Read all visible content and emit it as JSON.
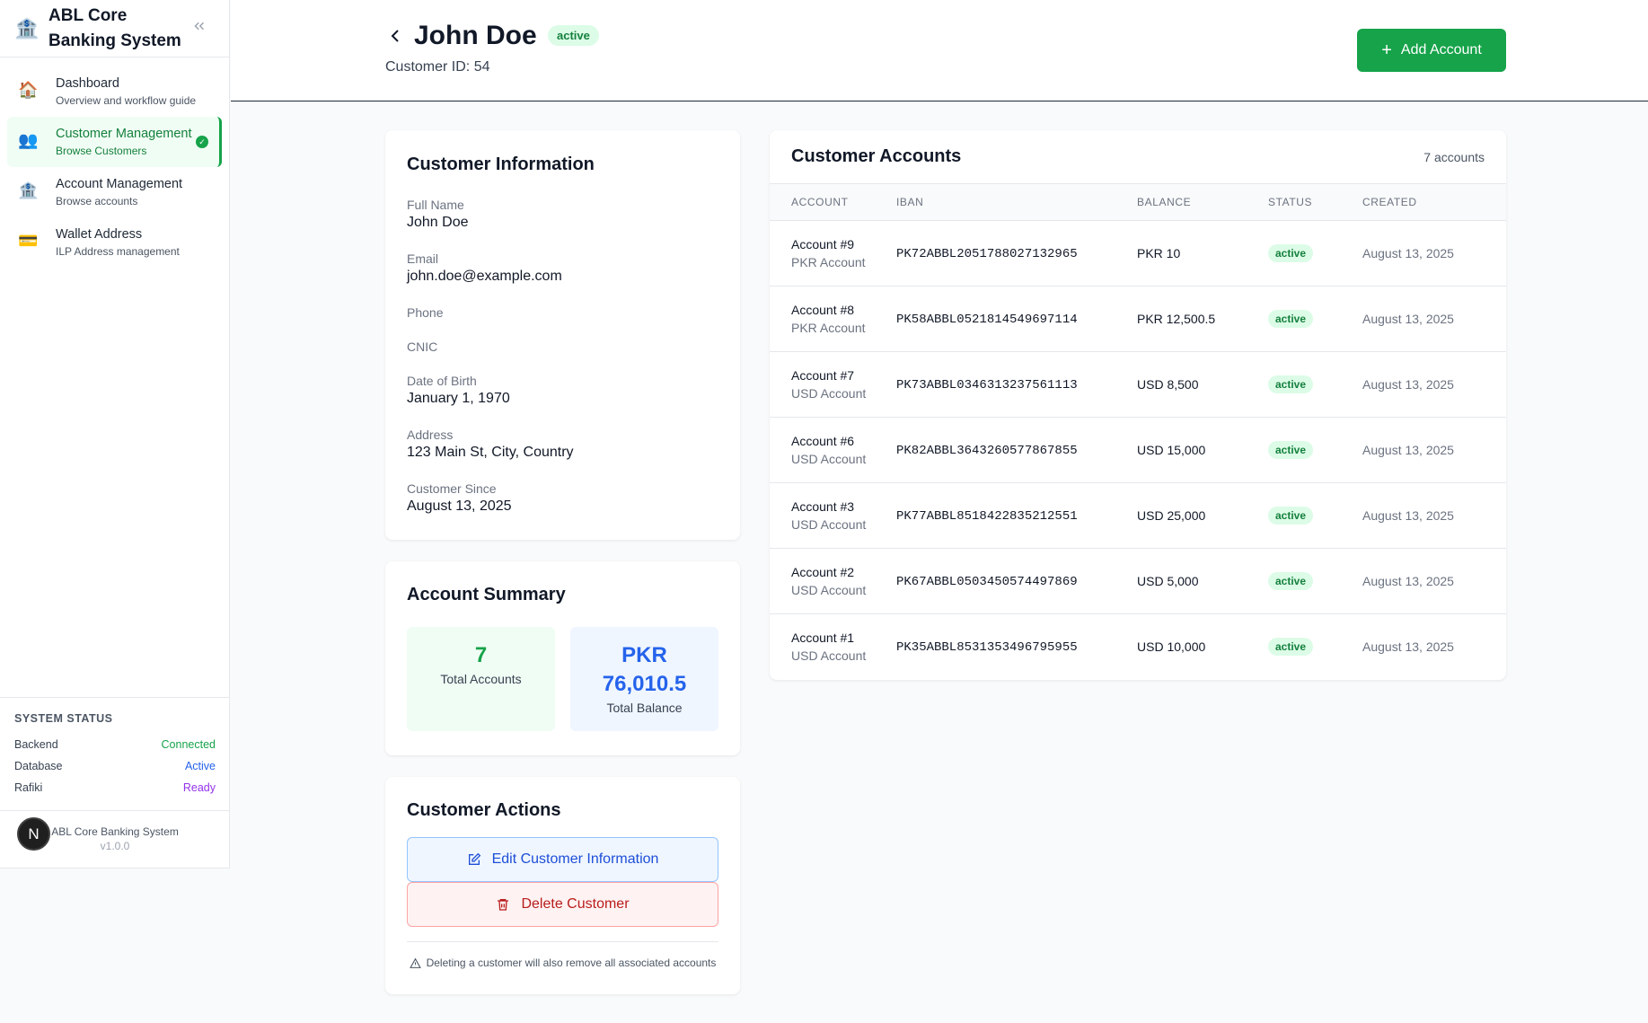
{
  "sidebar": {
    "brand": "ABL Core Banking System",
    "items": [
      {
        "label": "Dashboard",
        "sub": "Overview and workflow guide",
        "icon": "home-icon"
      },
      {
        "label": "Customer Management",
        "sub": "Browse Customers",
        "icon": "users-icon"
      },
      {
        "label": "Account Management",
        "sub": "Browse accounts",
        "icon": "bank-icon"
      },
      {
        "label": "Wallet Address",
        "sub": "ILP Address management",
        "icon": "card-icon"
      }
    ],
    "status": {
      "title": "SYSTEM STATUS",
      "rows": [
        {
          "name": "Backend",
          "value": "Connected",
          "color": "#16a34a"
        },
        {
          "name": "Database",
          "value": "Active",
          "color": "#2563eb"
        },
        {
          "name": "Rafiki",
          "value": "Ready",
          "color": "#9333ea"
        }
      ]
    },
    "footer": {
      "name": "ABL Core Banking System",
      "version": "v1.0.0",
      "avatar": "N"
    }
  },
  "header": {
    "name": "John Doe",
    "status": "active",
    "customer_id": "Customer ID: 54",
    "add_button": "Add Account"
  },
  "info": {
    "title": "Customer Information",
    "fields": [
      {
        "label": "Full Name",
        "value": "John Doe"
      },
      {
        "label": "Email",
        "value": "john.doe@example.com"
      },
      {
        "label": "Phone",
        "value": ""
      },
      {
        "label": "CNIC",
        "value": ""
      },
      {
        "label": "Date of Birth",
        "value": "January 1, 1970"
      },
      {
        "label": "Address",
        "value": "123 Main St, City, Country"
      },
      {
        "label": "Customer Since",
        "value": "August 13, 2025"
      }
    ]
  },
  "summary": {
    "title": "Account Summary",
    "total_accounts": "7",
    "total_accounts_label": "Total Accounts",
    "total_balance_currency": "PKR",
    "total_balance": "76,010.5",
    "total_balance_label": "Total Balance"
  },
  "actions": {
    "title": "Customer Actions",
    "edit": "Edit Customer Information",
    "delete": "Delete Customer",
    "warning": "Deleting a customer will also remove all associated accounts"
  },
  "accounts": {
    "title": "Customer Accounts",
    "count": "7 accounts",
    "columns": [
      "Account",
      "IBAN",
      "Balance",
      "Status",
      "Created"
    ],
    "rows": [
      {
        "account": "Account #9",
        "type": "PKR Account",
        "iban": "PK72ABBL2051788027132965",
        "balance": "PKR 10",
        "status": "active",
        "created": "August 13, 2025"
      },
      {
        "account": "Account #8",
        "type": "PKR Account",
        "iban": "PK58ABBL0521814549697114",
        "balance": "PKR 12,500.5",
        "status": "active",
        "created": "August 13, 2025"
      },
      {
        "account": "Account #7",
        "type": "USD Account",
        "iban": "PK73ABBL0346313237561113",
        "balance": "USD 8,500",
        "status": "active",
        "created": "August 13, 2025"
      },
      {
        "account": "Account #6",
        "type": "USD Account",
        "iban": "PK82ABBL3643260577867855",
        "balance": "USD 15,000",
        "status": "active",
        "created": "August 13, 2025"
      },
      {
        "account": "Account #3",
        "type": "USD Account",
        "iban": "PK77ABBL8518422835212551",
        "balance": "USD 25,000",
        "status": "active",
        "created": "August 13, 2025"
      },
      {
        "account": "Account #2",
        "type": "USD Account",
        "iban": "PK67ABBL0503450574497869",
        "balance": "USD 5,000",
        "status": "active",
        "created": "August 13, 2025"
      },
      {
        "account": "Account #1",
        "type": "USD Account",
        "iban": "PK35ABBL8531353496795955",
        "balance": "USD 10,000",
        "status": "active",
        "created": "August 13, 2025"
      }
    ]
  }
}
